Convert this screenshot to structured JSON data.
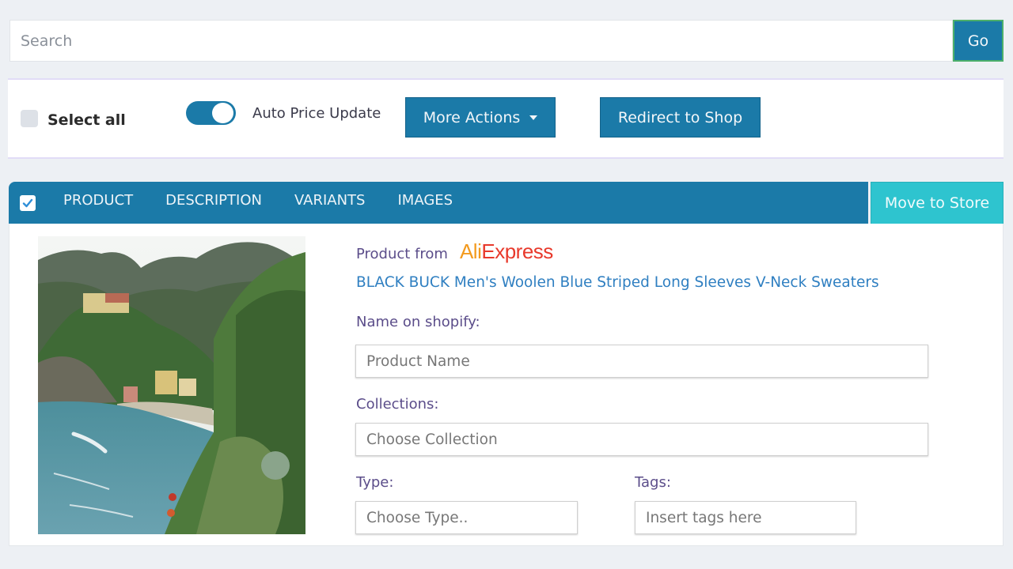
{
  "search": {
    "placeholder": "Search",
    "value": "",
    "go_label": "Go"
  },
  "actions": {
    "select_all_label": "Select all",
    "select_all_checked": false,
    "auto_price_label": "Auto Price Update",
    "auto_price_on": true,
    "more_actions_label": "More Actions",
    "redirect_label": "Redirect to Shop"
  },
  "card": {
    "checked": true,
    "tabs": [
      {
        "label": "PRODUCT"
      },
      {
        "label": "DESCRIPTION"
      },
      {
        "label": "VARIANTS"
      },
      {
        "label": "IMAGES"
      }
    ],
    "move_to_store_label": "Move to Store",
    "source_label": "Product from",
    "source_brand_part1": "Ali",
    "source_brand_part2": "Express",
    "product_title": "BLACK BUCK Men's Woolen Blue Striped Long Sleeves V-Neck Sweaters",
    "image_alt": "Coastal village with mountains and sea",
    "fields": {
      "name_label": "Name on shopify:",
      "name_placeholder": "Product Name",
      "collections_label": "Collections:",
      "collections_placeholder": "Choose Collection",
      "type_label": "Type:",
      "type_placeholder": "Choose Type..",
      "tags_label": "Tags:",
      "tags_placeholder": "Insert tags here"
    }
  },
  "colors": {
    "primary": "#1b7aa8",
    "accent": "#2ec4cf",
    "background": "#edf0f4",
    "label": "#5b4d8a",
    "link": "#2f7fc1"
  }
}
